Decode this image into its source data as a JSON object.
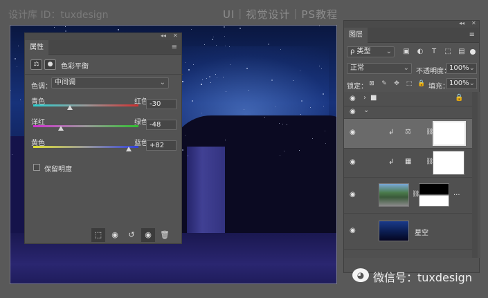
{
  "header": {
    "author": "设计库 ID：tuxdesign",
    "title": "UI｜视觉设计｜PS教程"
  },
  "properties_panel": {
    "collapse_glyph": "◂◂",
    "close_glyph": "✕",
    "tab_label": "属性",
    "menu_glyph": "≡",
    "adjustment_icon_glyph": "⚖",
    "mask_icon_glyph": "●",
    "adjustment_type": "色彩平衡",
    "tone_label": "色调：",
    "tone_value": "中间调",
    "sliders": [
      {
        "left": "青色",
        "right": "红色",
        "value": "-30",
        "level": -30
      },
      {
        "left": "洋红",
        "right": "绿色",
        "value": "-48",
        "level": -48
      },
      {
        "left": "黄色",
        "right": "蓝色",
        "value": "+82",
        "level": 82
      }
    ],
    "preserve_label": "保留明度",
    "preserve_checked": false,
    "bottom_buttons": [
      {
        "name": "clip-to-layer-icon",
        "glyph": "⬚"
      },
      {
        "name": "view-previous-icon",
        "glyph": "◉"
      },
      {
        "name": "reset-icon",
        "glyph": "↺"
      },
      {
        "name": "visibility-icon",
        "glyph": "◉"
      },
      {
        "name": "trash-icon",
        "glyph": "🗑"
      }
    ]
  },
  "layers_panel": {
    "collapse_glyph": "◂◂",
    "close_glyph": "✕",
    "tab_label": "图层",
    "menu_glyph": "≡",
    "filter_label": "ρ 类型",
    "filter_icons": [
      "▣",
      "◐",
      "T",
      "⬚",
      "▤"
    ],
    "blend_mode": "正常",
    "opacity_label": "不透明度：",
    "opacity_value": "100%",
    "lock_label": "锁定：",
    "lock_icons": [
      "⊠",
      "✎",
      "✥",
      "⬚",
      "🔒"
    ],
    "fill_label": "填充：",
    "fill_value": "100%",
    "eye_glyph": "◉",
    "group_toggle_glyph": "›",
    "folder_glyph": "■",
    "lock_glyph": "🔒",
    "expand_glyph": "⌄",
    "clip_arrow_glyph": "↲",
    "adj_glyphs": [
      "⚖",
      "▦"
    ],
    "chain_glyph": "⛓",
    "ellipsis": "...",
    "bg_layer_name": "星空"
  },
  "watermark": {
    "glyph": "◕",
    "text": "微信号：tuxdesign"
  },
  "colors": {
    "panel_bg": "#535353",
    "workspace_bg": "#595959",
    "canvas_sky": "#17327a"
  }
}
